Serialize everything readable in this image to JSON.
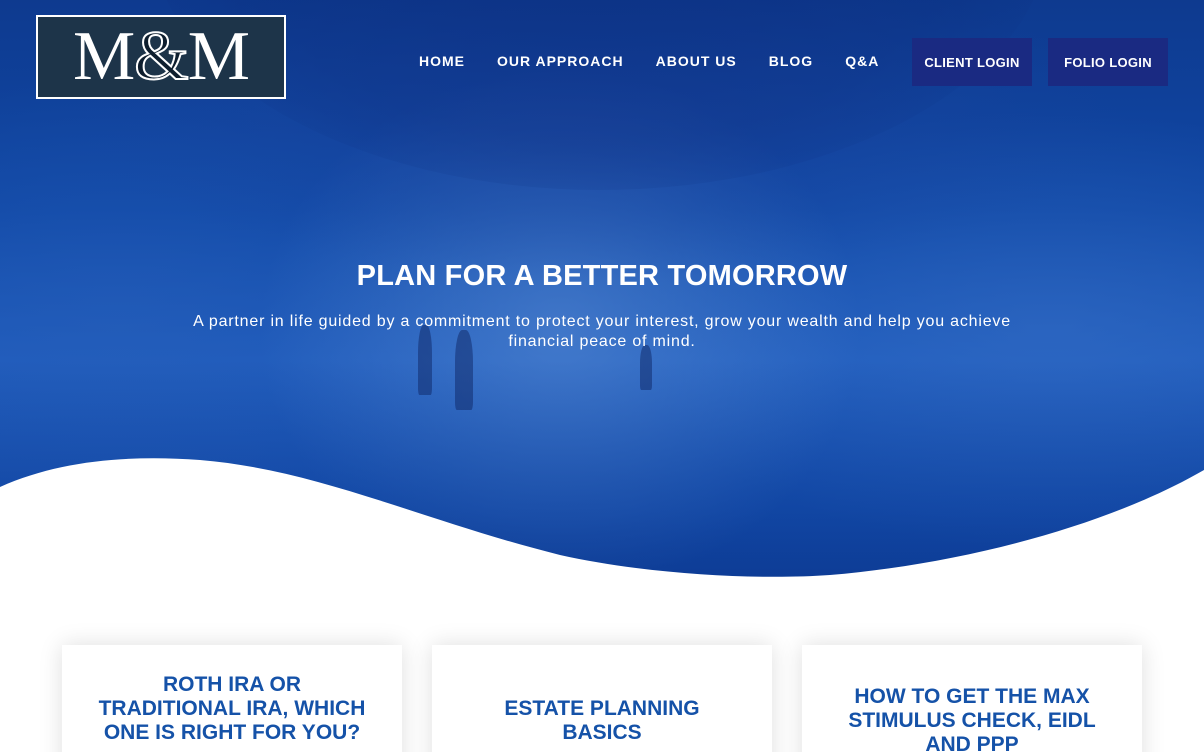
{
  "logo": {
    "left": "M",
    "amp": "&",
    "right": "M",
    "alt": "M&M"
  },
  "nav": {
    "items": [
      {
        "label": "HOME"
      },
      {
        "label": "OUR APPROACH"
      },
      {
        "label": "ABOUT US"
      },
      {
        "label": "BLOG"
      },
      {
        "label": "Q&A"
      }
    ]
  },
  "buttons": {
    "client_login": "CLIENT LOGIN",
    "folio_login": "FOLIO LOGIN"
  },
  "hero": {
    "title": "PLAN FOR A BETTER TOMORROW",
    "subtitle": "A partner in life guided by a commitment to protect your interest, grow your wealth and help you achieve financial peace of mind."
  },
  "cards": [
    {
      "title": "ROTH IRA OR TRADITIONAL IRA, WHICH ONE IS RIGHT FOR YOU?"
    },
    {
      "title": "ESTATE PLANNING BASICS"
    },
    {
      "title": "HOW TO GET THE MAX STIMULUS CHECK, EIDL AND PPP"
    }
  ],
  "colors": {
    "hero_blue": "#1048a6",
    "button_navy": "#1a2a82",
    "card_title_blue": "#1552a8",
    "logo_bg": "#1d3449"
  }
}
